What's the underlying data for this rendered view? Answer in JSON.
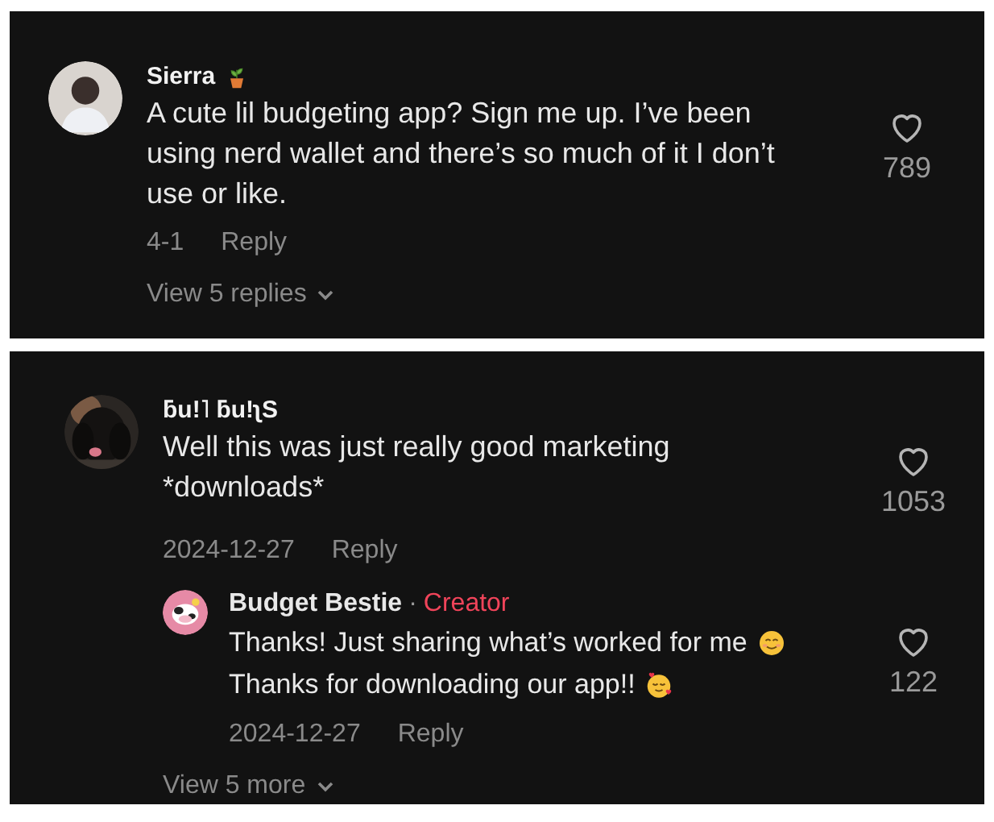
{
  "threads": [
    {
      "comments": [
        {
          "author": "Sierra",
          "text": "A cute lil budgeting app? Sign me up. I’ve been using nerd wallet and there’s so much of it I don’t use or like.",
          "date": "4-1",
          "reply": "Reply",
          "likes": "789"
        }
      ],
      "more": "View 5 replies"
    },
    {
      "comments": [
        {
          "author": "ƃu!˥ ƃu!ʅS",
          "text": "Well this was just really good marketing *downloads*",
          "date": "2024-12-27",
          "reply": "Reply",
          "likes": "1053",
          "replies": [
            {
              "author": "Budget Bestie",
              "separator": "·",
              "creator_label": "Creator",
              "lines": [
                "Thanks! Just sharing what’s worked for me",
                "Thanks for downloading our app!!"
              ],
              "date": "2024-12-27",
              "reply": "Reply",
              "likes": "122"
            }
          ]
        }
      ],
      "more": "View 5 more"
    }
  ]
}
